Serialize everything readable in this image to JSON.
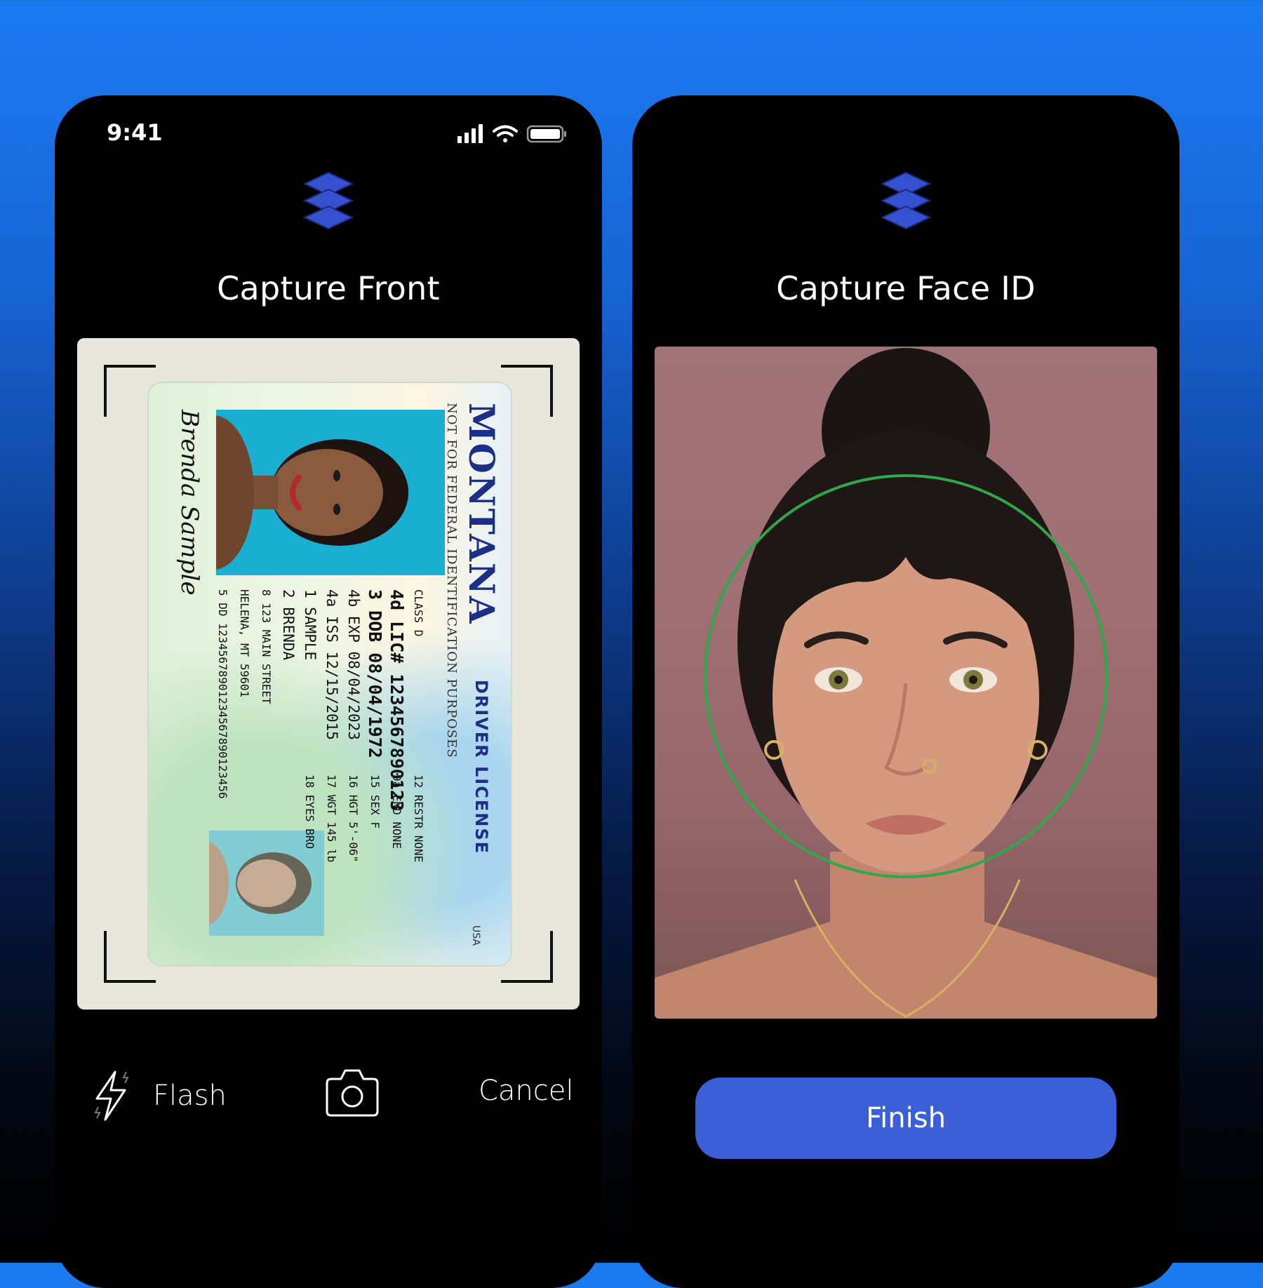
{
  "colors": {
    "background_top": "#1b7bf2",
    "background_bottom": "#000000",
    "accent": "#3b5fd6",
    "logo": "#3550d0",
    "face_guide": "#2fa84a"
  },
  "status_bar": {
    "time": "9:41",
    "icons": [
      "signal-icon",
      "wifi-icon",
      "battery-icon"
    ]
  },
  "screen_front": {
    "logo_icon": "stacked-layers-logo",
    "title": "Capture Front",
    "id_card": {
      "state": "MONTANA",
      "doc_type": "DRIVER LICENSE",
      "notice": "NOT FOR FEDERAL IDENTIFICATION PURPOSES",
      "country": "USA",
      "signature": "Brenda Sample",
      "fields": [
        {
          "line": "CLASS D",
          "style": "small"
        },
        {
          "line": "4d LIC# 1234567890123",
          "style": "big"
        },
        {
          "line": "3 DOB 08/04/1972",
          "style": "big"
        },
        {
          "line": "4b EXP 08/04/2023",
          "style": "normal"
        },
        {
          "line": "4a ISS 12/15/2015",
          "style": "normal"
        },
        {
          "line": "1 SAMPLE",
          "style": "normal"
        },
        {
          "line": "2 BRENDA",
          "style": "normal"
        },
        {
          "line": "8 123 MAIN STREET",
          "style": "small"
        },
        {
          "line": "HELENA, MT 59601",
          "style": "small"
        },
        {
          "line": "5 DD 12345678901234567890123456",
          "style": "small"
        }
      ],
      "extra": [
        {
          "line": "12 RESTR NONE",
          "style": "small"
        },
        {
          "line": "9a END NONE",
          "style": "small"
        },
        {
          "line": "15 SEX F",
          "style": "small"
        },
        {
          "line": "16 HGT 5'-06\"",
          "style": "small"
        },
        {
          "line": "17 WGT 145 lb",
          "style": "small"
        },
        {
          "line": "18 EYES BRO",
          "style": "small"
        }
      ]
    },
    "controls": {
      "flash_icon": "flash-icon",
      "flash_label": "Flash",
      "shutter_icon": "camera-icon",
      "cancel_label": "Cancel"
    }
  },
  "screen_face": {
    "logo_icon": "stacked-layers-logo",
    "title": "Capture Face ID",
    "finish_label": "Finish"
  }
}
